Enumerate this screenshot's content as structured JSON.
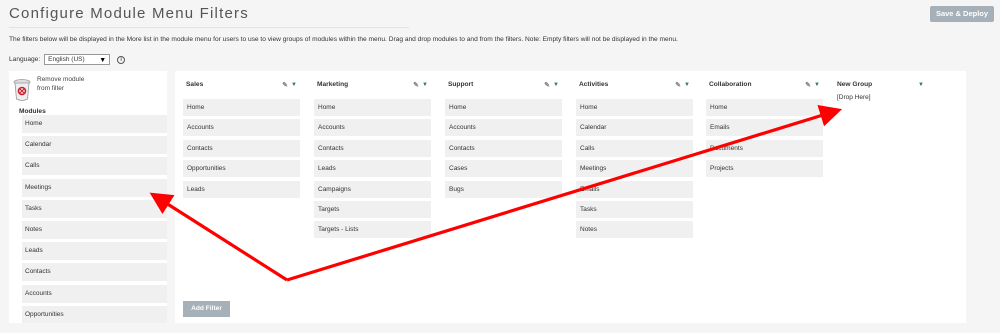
{
  "header": {
    "title": "Configure Module Menu Filters",
    "deploy_label": "Save & Deploy"
  },
  "description": "The filters below will be displayed in the More list in the module menu for users to use to view groups of modules within the menu. Drag and drop modules to and from the filters. Note: Empty filters will not be displayed in the menu.",
  "language": {
    "label": "Language:",
    "selected": "English (US)"
  },
  "left_panel": {
    "remove_label_1": "Remove module",
    "remove_label_2": "from filter",
    "modules_label": "Modules",
    "modules": [
      "Home",
      "Calendar",
      "Calls",
      "Meetings",
      "Tasks",
      "Notes",
      "Leads",
      "Contacts",
      "Accounts",
      "Opportunities"
    ]
  },
  "groups": [
    {
      "name": "Sales",
      "items": [
        "Home",
        "Accounts",
        "Contacts",
        "Opportunities",
        "Leads"
      ]
    },
    {
      "name": "Marketing",
      "items": [
        "Home",
        "Accounts",
        "Contacts",
        "Leads",
        "Campaigns",
        "Targets",
        "Targets - Lists"
      ]
    },
    {
      "name": "Support",
      "items": [
        "Home",
        "Accounts",
        "Contacts",
        "Cases",
        "Bugs"
      ]
    },
    {
      "name": "Activities",
      "items": [
        "Home",
        "Calendar",
        "Calls",
        "Meetings",
        "Emails",
        "Tasks",
        "Notes"
      ]
    },
    {
      "name": "Collaboration",
      "items": [
        "Home",
        "Emails",
        "Documents",
        "Projects"
      ]
    }
  ],
  "new_group": {
    "name": "New Group",
    "drop_here": "[Drop Here]"
  },
  "add_filter_label": "Add Filter",
  "colors": {
    "button_bg": "#a5b0b9",
    "arrow": "#ff0000",
    "delete_icon": "#2a7d6a"
  }
}
